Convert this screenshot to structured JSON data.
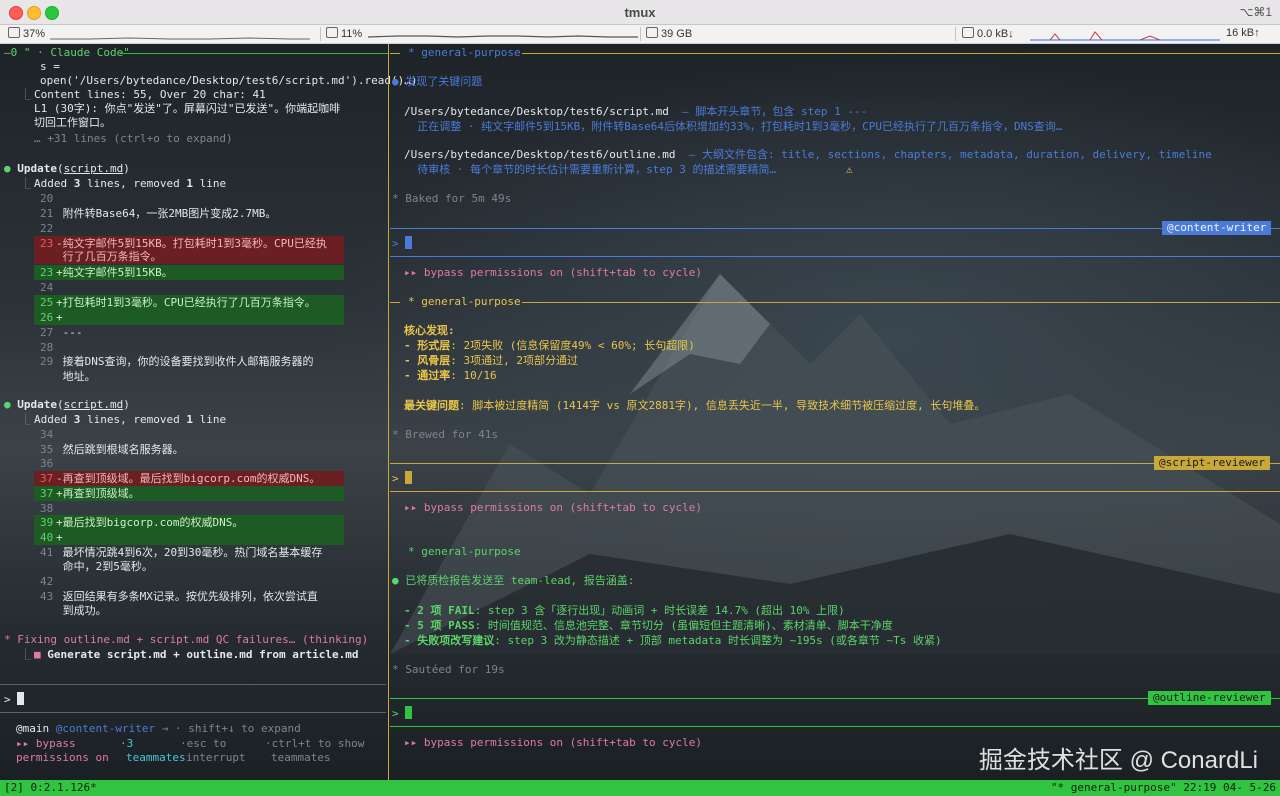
{
  "window": {
    "title": "tmux",
    "shortcut": "⌥⌘1"
  },
  "stats": {
    "cpu": "37%",
    "gpu": "11%",
    "disk": "39 GB",
    "net_up": "0.0 kB↓",
    "net_down": "16 kB↑"
  },
  "left_pane": {
    "header": "—0 \" · Claude Code\"",
    "read_lines": [
      "s =",
      "open('/Users/bytedance/Desktop/test6/script.md').read()…)"
    ],
    "content_info": "Content lines: 55, Over 20 char: 41",
    "l1_line": "L1 (30字): 你点\"发送\"了。屏幕闪过\"已发送\"。你端起咖啡",
    "l1_cont": "切回工作窗口。",
    "more_lines": "… +31 lines (ctrl+o to expand)",
    "update1": {
      "title_prefix": "Update",
      "title_file": "script.md",
      "summary_a": "Added ",
      "summary_n1": "3",
      "summary_b": " lines, removed ",
      "summary_n2": "1",
      "summary_c": " line",
      "lines": [
        {
          "num": "20",
          "text": ""
        },
        {
          "num": "21",
          "text": " 附件转Base64，一张2MB图片变成2.7MB。"
        },
        {
          "num": "22",
          "text": ""
        },
        {
          "num": "23",
          "text": "-纯文字邮件5到15KB。打包耗时1到3毫秒。CPU已经执"
        },
        {
          "num": "",
          "text": " 行了几百万条指令。"
        },
        {
          "num": "23",
          "text": "+纯文字邮件5到15KB。"
        },
        {
          "num": "24",
          "text": ""
        },
        {
          "num": "25",
          "text": "+打包耗时1到3毫秒。CPU已经执行了几百万条指令。"
        },
        {
          "num": "26",
          "text": "+"
        },
        {
          "num": "27",
          "text": " ---"
        },
        {
          "num": "28",
          "text": ""
        },
        {
          "num": "29",
          "text": " 接着DNS查询，你的设备要找到收件人邮箱服务器的"
        },
        {
          "num": "",
          "text": " 地址。"
        }
      ]
    },
    "update2": {
      "title_prefix": "Update",
      "title_file": "script.md",
      "summary_a": "Added ",
      "summary_n1": "3",
      "summary_b": " lines, removed ",
      "summary_n2": "1",
      "summary_c": " line",
      "lines": [
        {
          "num": "34",
          "text": ""
        },
        {
          "num": "35",
          "text": " 然后跳到根域名服务器。"
        },
        {
          "num": "36",
          "text": ""
        },
        {
          "num": "37",
          "text": "-再查到顶级域。最后找到bigcorp.com的权威DNS。"
        },
        {
          "num": "37",
          "text": "+再查到顶级域。"
        },
        {
          "num": "38",
          "text": ""
        },
        {
          "num": "39",
          "text": "+最后找到bigcorp.com的权威DNS。"
        },
        {
          "num": "40",
          "text": "+"
        },
        {
          "num": "41",
          "text": " 最坏情况跳4到6次，20到30毫秒。热门域名基本缓存"
        },
        {
          "num": "",
          "text": " 命中，2到5毫秒。"
        },
        {
          "num": "42",
          "text": ""
        },
        {
          "num": "43",
          "text": " 返回结果有多条MX记录。按优先级排列，依次尝试直"
        },
        {
          "num": "",
          "text": " 到成功。"
        }
      ]
    },
    "fixing": "* Fixing outline.md + script.md QC failures… (thinking)",
    "task": "Generate script.md + outline.md from article.md",
    "prompt": ">",
    "footer": {
      "main": "@main",
      "agent": "@content-writer",
      "arrow": "→ · shift+↓ to expand",
      "bypass_a": "▸▸ bypass",
      "bypass_b": "permissions on",
      "count_a": "·3",
      "count_b": "teammates",
      "esc_a": "·esc to",
      "esc_b": "interrupt",
      "ctrl_a": "·ctrl+t to show",
      "ctrl_b": "teammates"
    }
  },
  "right_pane": {
    "section1": {
      "header": "* general-purpose",
      "first": "● 发现了关键问题",
      "path1": "/Users/bytedance/Desktop/test6/script.md",
      "path1_desc": "  — 脚本开头章节，包含 step 1 ---",
      "path1_cont": "  正在调整 · 纯文字邮件5到15KB，附件转Base64后体积增加约33%，打包耗时1到3毫秒，CPU已经执行了几百万条指令，DNS查询…",
      "path2": "/Users/bytedance/Desktop/test6/outline.md",
      "path2_desc": "  — 大纲文件包含: title, sections, chapters, metadata, duration, delivery, timeline",
      "path2_cont": "  待审核 · 每个章节的时长估计需要重新计算，step 3 的描述需要精简…",
      "done": "* Baked for 5m 49s",
      "tag": "@content-writer",
      "prompt": ">",
      "bypass": "▸▸ bypass permissions on (shift+tab to cycle)"
    },
    "section2": {
      "header": "* general-purpose",
      "core": "核心发现:",
      "b1_label": "- 形式层",
      "b1_text": ": 2项失败 (信息保留度49% < 60%; 长句超限)",
      "b2_label": "- 风骨层",
      "b2_text": ": 3项通过, 2项部分通过",
      "b3_label": "- 通过率",
      "b3_text": ": 10/16",
      "key_label": "最关键问题",
      "key_text": ": 脚本被过度精简 (1414字 vs 原文2881字), 信息丢失近一半, 导致技术细节被压缩过度, 长句堆叠。",
      "done": "* Brewed for 41s",
      "tag": "@script-reviewer",
      "prompt": ">",
      "bypass": "▸▸ bypass permissions on (shift+tab to cycle)"
    },
    "section3": {
      "header": "* general-purpose",
      "first": "● 已将质检报告发送至 team-lead, 报告涵盖:",
      "b1_label": "- 2 项 FAIL",
      "b1_text": ": step 3 含「逐行出现」动画词 + 时长误差 14.7% (超出 10% 上限)",
      "b2_label": "- 5 项 PASS",
      "b2_text": ": 时间值规范、信息池完整、章节切分 (虽偏短但主题清晰)、素材清单、脚本干净度",
      "b3_label": "- 失败项改写建议",
      "b3_text": ": step 3 改为静态描述 + 顶部 metadata 时长调整为 ~195s (或各章节 ~Ts 收紧)",
      "done": "* Sautéed for 19s",
      "tag": "@outline-reviewer",
      "prompt": ">",
      "bypass": "▸▸ bypass permissions on (shift+tab to cycle)"
    }
  },
  "status_bar": {
    "left": "[2] 0:2.1.126*",
    "right": "\"* general-purpose\" 22:19 04- 5-26"
  },
  "watermark": "掘金技术社区 @ ConardLi",
  "colors": {
    "accent_green": "#31c440",
    "accent_blue": "#4b7bd8",
    "accent_yellow": "#e8c54a",
    "diff_removed": "#6b1f22",
    "diff_added": "#1e5a24"
  }
}
